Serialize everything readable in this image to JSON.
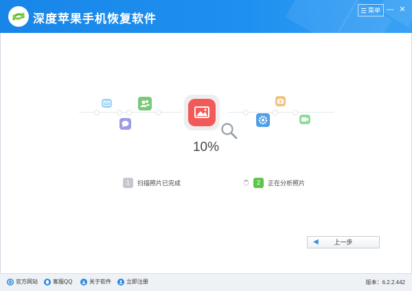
{
  "window": {
    "title": "深度苹果手机恢复软件",
    "menu_label": "菜单",
    "min_glyph": "—",
    "close_glyph": "✕"
  },
  "progress": {
    "text": "10%",
    "value_percent": 10
  },
  "steps": [
    {
      "number": "1",
      "label": "扫描照片已完成",
      "state": "done",
      "color": "#c5c8cc"
    },
    {
      "number": "2",
      "label": "正在分析照片",
      "state": "active",
      "color": "#5cc64a"
    }
  ],
  "nav": {
    "back_label": "上一步",
    "back_arrow": "◀"
  },
  "footer": {
    "links": [
      {
        "label": "官方网站",
        "icon": "globe-icon"
      },
      {
        "label": "客服QQ",
        "icon": "qq-icon"
      },
      {
        "label": "关于软件",
        "icon": "download-icon"
      },
      {
        "label": "立即注册",
        "icon": "user-register-icon"
      }
    ],
    "version": "版本：6.2.2.442"
  },
  "colors": {
    "titlebar": "#1e8ff0",
    "photo_icon": "#f25a5a",
    "step_active": "#5cc64a",
    "step_done": "#c5c8cc"
  },
  "scene_icons": [
    "mail-icon",
    "contacts-icon",
    "chat-icon",
    "photo-icon",
    "magnifier-icon",
    "camera-icon",
    "settings-icon",
    "video-icon"
  ]
}
